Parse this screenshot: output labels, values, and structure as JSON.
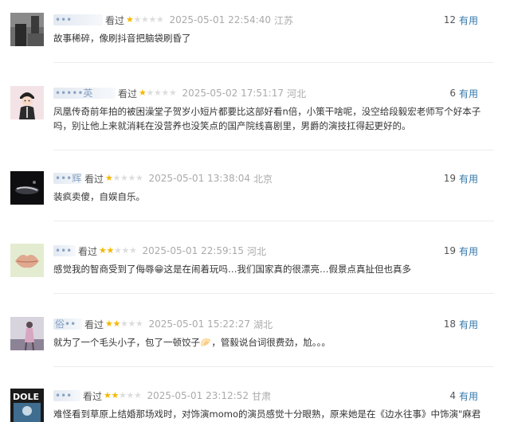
{
  "comments": [
    {
      "user": "•••",
      "status": "看过",
      "rating": 1,
      "time": "2025-05-01 22:54:40",
      "location": "江苏",
      "useful_count": "12",
      "useful_label": "有用",
      "content": "故事稀碎，像刷抖音把脑袋刷昏了",
      "avatar_icon": "dark-figure-avatar-icon"
    },
    {
      "user": "•••••英",
      "status": "看过",
      "rating": 1,
      "time": "2025-05-02 17:51:17",
      "location": "河北",
      "useful_count": "6",
      "useful_label": "有用",
      "content": "凤凰传奇前年拍的被困澡堂子贺岁小短片都要比这部好看n倍，小策干啥呢，没空给段毅宏老师写个好本子吗，别让他上来就消耗在没营养也没笑点的国产院线喜剧里，男爵的演技扛得起更好的。",
      "avatar_icon": "cartoon-character-avatar-icon"
    },
    {
      "user": "•••辉",
      "status": "看过",
      "rating": 1,
      "time": "2025-05-01 13:38:04",
      "location": "北京",
      "useful_count": "19",
      "useful_label": "有用",
      "content": "装疯卖傻，自娱自乐。",
      "avatar_icon": "night-scene-avatar-icon"
    },
    {
      "user": "•••",
      "status": "看过",
      "rating": 2,
      "time": "2025-05-01 22:59:15",
      "location": "河北",
      "useful_count": "19",
      "useful_label": "有用",
      "content": "感觉我的智商受到了侮辱😁这是在闹着玩吗…我们国家真的很漂亮…假景点真扯但也真多",
      "avatar_icon": "lips-avatar-icon"
    },
    {
      "user": "俗••",
      "status": "看过",
      "rating": 2,
      "time": "2025-05-01 15:22:27",
      "location": "湖北",
      "useful_count": "18",
      "useful_label": "有用",
      "content": "就为了一个毛头小子，包了一顿饺子🥟，管毅说台词很费劲，尬。。。",
      "avatar_icon": "girl-photo-avatar-icon"
    },
    {
      "user": "•••",
      "status": "看过",
      "rating": 2,
      "time": "2025-05-01 23:12:52",
      "location": "甘肃",
      "useful_count": "4",
      "useful_label": "有用",
      "content": "难怪看到草原上结婚那场戏时，对饰演momo的演员感觉十分眼熟，原来她是在《边水往事》中饰演\"麻君",
      "avatar_icon": "poster-avatar-icon"
    }
  ],
  "colors": {
    "star_on": "#f5b700",
    "star_off": "#dddddd",
    "link": "#3377aa",
    "time": "#aaaaaa"
  }
}
